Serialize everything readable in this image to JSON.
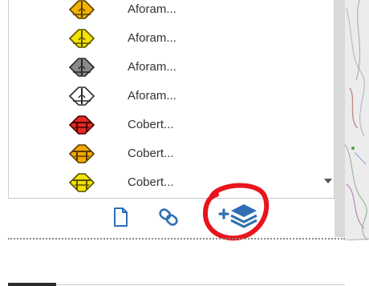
{
  "legend": {
    "items": [
      {
        "label": "Aforam...",
        "fill": "#f2b300",
        "stroke": "#5a4000",
        "glyph": "flow"
      },
      {
        "label": "Aforam...",
        "fill": "#f3e300",
        "stroke": "#5a5000",
        "glyph": "flow"
      },
      {
        "label": "Aforam...",
        "fill": "#8a8a8a",
        "stroke": "#2b2b2b",
        "glyph": "flow"
      },
      {
        "label": "Aforam...",
        "fill": "#ffffff",
        "stroke": "#2b2b2b",
        "glyph": "flow"
      },
      {
        "label": "Cobert...",
        "fill": "#e12a22",
        "stroke": "#4a0000",
        "glyph": "table"
      },
      {
        "label": "Cobert...",
        "fill": "#f2a900",
        "stroke": "#5a3a00",
        "glyph": "table"
      },
      {
        "label": "Cobert...",
        "fill": "#f3e300",
        "stroke": "#5a5000",
        "glyph": "table"
      }
    ]
  },
  "toolbar": {
    "buttons": [
      {
        "name": "new-document-button",
        "icon": "document-icon"
      },
      {
        "name": "link-button",
        "icon": "link-icon"
      },
      {
        "name": "add-layer-button",
        "icon": "add-layer-icon",
        "highlighted": true
      }
    ]
  },
  "colors": {
    "accent": "#2f6fb3",
    "highlight_circle": "#e8141c"
  }
}
